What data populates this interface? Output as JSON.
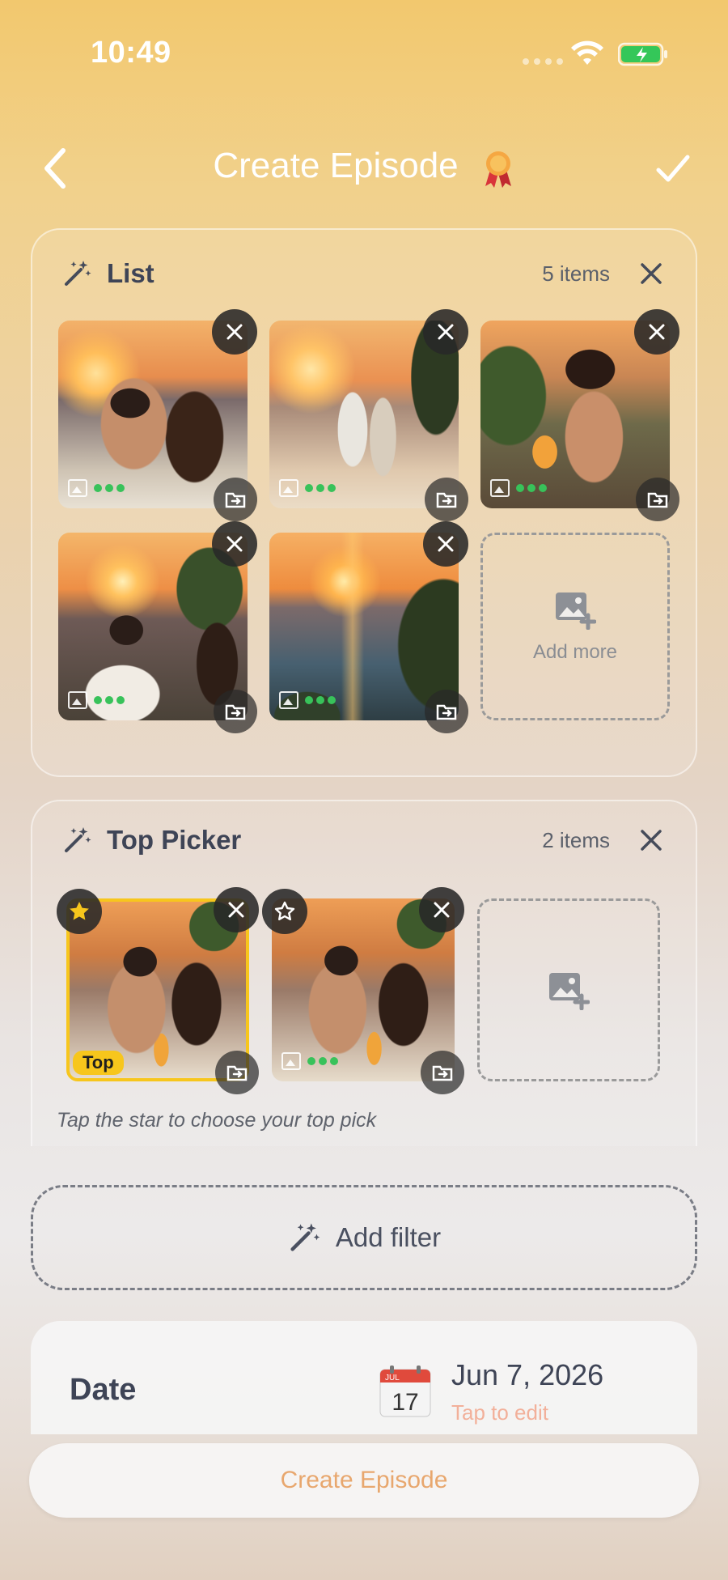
{
  "status": {
    "time": "10:49"
  },
  "nav": {
    "title": "Create Episode"
  },
  "list_card": {
    "title": "List",
    "count": "5 items",
    "add_more": "Add more"
  },
  "top_card": {
    "title": "Top Picker",
    "count": "2 items",
    "top_badge": "Top",
    "hint": "Tap the star to choose your top pick"
  },
  "filter": {
    "label": "Add filter"
  },
  "date": {
    "label": "Date",
    "calendar_month": "JUL",
    "calendar_day": "17",
    "value": "Jun 7, 2026",
    "edit_hint": "Tap to edit"
  },
  "create_button": {
    "label": "Create Episode"
  },
  "colors": {
    "accent": "#f7c61c",
    "status_green": "#38c25a",
    "cta_text": "#e8a76e"
  }
}
